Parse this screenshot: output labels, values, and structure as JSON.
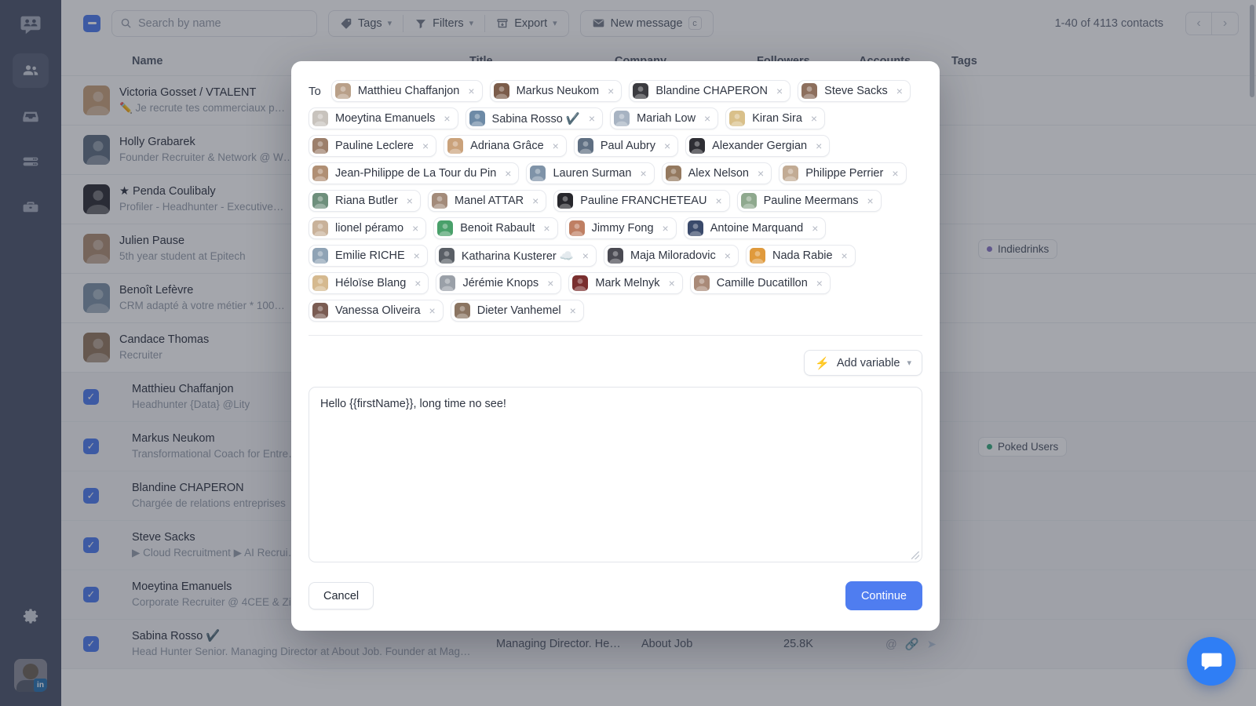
{
  "sidebar": {
    "logo_icon": "people-bubble-logo",
    "items": [
      {
        "icon": "people-icon",
        "name": "contacts",
        "active": true
      },
      {
        "icon": "inbox-icon",
        "name": "inbox",
        "active": false
      },
      {
        "icon": "list-icon",
        "name": "sequences",
        "active": false
      },
      {
        "icon": "briefcase-icon",
        "name": "jobs",
        "active": false
      }
    ],
    "settings_icon": "gear-icon",
    "avatar_badge": "in"
  },
  "toolbar": {
    "select_all_state": "indeterminate",
    "search_placeholder": "Search by name",
    "search_value": "",
    "tags_label": "Tags",
    "filters_label": "Filters",
    "export_label": "Export",
    "new_message_label": "New message",
    "new_message_shortcut": "c",
    "contacts_count": "1-40 of 4113 contacts"
  },
  "table": {
    "columns": [
      "Name",
      "Title",
      "Company",
      "Followers",
      "Accounts",
      "Tags"
    ],
    "rows": [
      {
        "name": "Victoria Gosset / VTALENT",
        "subtitle": "✏️ Je recrute tes commerciaux p…",
        "selected": false,
        "title": "",
        "company": "",
        "followers": "",
        "tag": "",
        "tag_color": ""
      },
      {
        "name": "Holly Grabarek",
        "subtitle": "Founder Recruiter & Network @ W…",
        "selected": false,
        "title": "",
        "company": "",
        "followers": "",
        "tag": "",
        "tag_color": ""
      },
      {
        "name": "★ Penda Coulibaly",
        "subtitle": "Profiler - Headhunter - Executive…",
        "selected": false,
        "title": "",
        "company": "",
        "followers": "",
        "tag": "",
        "tag_color": ""
      },
      {
        "name": "Julien Pause",
        "subtitle": "5th year student at Epitech",
        "selected": false,
        "title": "",
        "company": "",
        "followers": "",
        "tag": "Indiedrinks",
        "tag_color": "#8b77c9"
      },
      {
        "name": "Benoît Lefèvre",
        "subtitle": "CRM adapté à votre métier * 100…",
        "selected": false,
        "title": "",
        "company": "",
        "followers": "",
        "tag": "",
        "tag_color": ""
      },
      {
        "name": "Candace Thomas",
        "subtitle": "Recruiter",
        "selected": false,
        "title": "",
        "company": "",
        "followers": "",
        "tag": "",
        "tag_color": ""
      },
      {
        "name": "Matthieu Chaffanjon",
        "subtitle": "Headhunter {Data} @Lity",
        "selected": true,
        "title": "",
        "company": "",
        "followers": "",
        "tag": "",
        "tag_color": ""
      },
      {
        "name": "Markus Neukom",
        "subtitle": "Transformational Coach for Entre…",
        "selected": true,
        "title": "",
        "company": "",
        "followers": "",
        "tag": "Poked Users",
        "tag_color": "#3aab7e"
      },
      {
        "name": "Blandine CHAPERON",
        "subtitle": "Chargée de relations entreprises",
        "selected": true,
        "title": "",
        "company": "",
        "followers": "",
        "tag": "",
        "tag_color": ""
      },
      {
        "name": "Steve Sacks",
        "subtitle": "▶ Cloud Recruitment ▶ AI Recrui…",
        "selected": true,
        "title": "",
        "company": "",
        "followers": "",
        "tag": "",
        "tag_color": ""
      },
      {
        "name": "Moeytina Emanuels",
        "subtitle": "Corporate Recruiter @ 4CEE & Zi…",
        "selected": true,
        "title": "",
        "company": "",
        "followers": "",
        "tag": "",
        "tag_color": ""
      },
      {
        "name": "Sabina Rosso ✔️",
        "subtitle": "Head Hunter Senior. Managing Director at About Job. Founder at Mag…",
        "selected": true,
        "title": "Managing Director. He…",
        "company": "About Job",
        "followers": "25.8K",
        "tag": "",
        "tag_color": ""
      }
    ]
  },
  "modal": {
    "to_label": "To",
    "recipients": [
      "Matthieu Chaffanjon",
      "Markus Neukom",
      "Blandine CHAPERON",
      "Steve Sacks",
      "Moeytina Emanuels",
      "Sabina Rosso ✔️",
      "Mariah Low",
      "Kiran Sira",
      "Pauline Leclere",
      "Adriana Grâce",
      "Paul Aubry",
      "Alexander Gergian",
      "Jean-Philippe de La Tour du Pin",
      "Lauren Surman",
      "Alex Nelson",
      "Philippe Perrier",
      "Riana Butler",
      "Manel ATTAR",
      "Pauline FRANCHETEAU",
      "Pauline Meermans",
      "lionel péramo",
      "Benoit Rabault",
      "Jimmy Fong",
      "Antoine Marquand",
      "Emilie RICHE",
      "Katharina Kusterer ☁️",
      "Maja Miloradovic",
      "Nada Rabie",
      "Héloïse Blang",
      "Jérémie Knops",
      "Mark Melnyk",
      "Camille Ducatillon",
      "Vanessa Oliveira",
      "Dieter Vanhemel"
    ],
    "add_variable_label": "Add variable",
    "message_value": "Hello {{firstName}}, long time no see!",
    "message_placeholder": "",
    "cancel_label": "Cancel",
    "continue_label": "Continue",
    "accent_color": "#4f7df0"
  },
  "fab": {
    "icon": "chat-bubble-icon",
    "color": "#2f7ef5"
  }
}
